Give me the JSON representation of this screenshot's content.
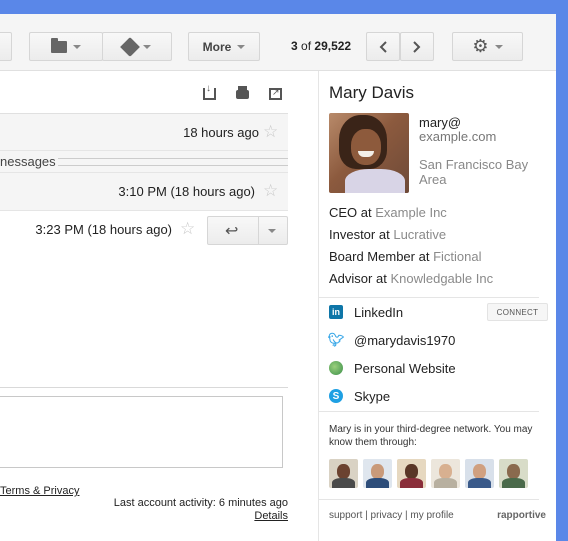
{
  "toolbar": {
    "more_label": "More",
    "count_current": "3",
    "count_of": "of",
    "count_total": "29,522"
  },
  "thread": {
    "messages": [
      {
        "time": "18 hours ago"
      },
      {
        "collapsed_label": "nessages"
      },
      {
        "time": "3:10 PM (18 hours ago)"
      },
      {
        "time": "3:23 PM (18 hours ago)"
      }
    ],
    "terms_link": "Terms & Privacy",
    "last_activity": "Last account activity: 6 minutes ago",
    "details_link": "Details"
  },
  "contact": {
    "name": "Mary Davis",
    "email_line1": "mary@",
    "email_line2": "example.com",
    "location": "San Francisco Bay Area",
    "jobs": [
      {
        "title": "CEO",
        "at": "at",
        "org": "Example Inc"
      },
      {
        "title": "Investor",
        "at": "at",
        "org": "Lucrative"
      },
      {
        "title": "Board Member",
        "at": "at",
        "org": "Fictional"
      },
      {
        "title": "Advisor",
        "at": "at",
        "org": "Knowledgable Inc"
      }
    ],
    "social": {
      "linkedin": "LinkedIn",
      "connect": "CONNECT",
      "twitter": "@marydavis1970",
      "website": "Personal Website",
      "skype": "Skype"
    },
    "network_text": "Mary is in your third-degree network. You may know them through:",
    "avatars": [
      {
        "skin": "#6b4230",
        "hair": "#2a1a10",
        "body": "#4a4a4a"
      },
      {
        "skin": "#c99a7a",
        "hair": "#3a2a1e",
        "body": "#2d4d7a"
      },
      {
        "skin": "#5a3626",
        "hair": "#1e140c",
        "body": "#8a2e3a"
      },
      {
        "skin": "#d8b090",
        "hair": "#6a4a30",
        "body": "#b8b0a0"
      },
      {
        "skin": "#d0a080",
        "hair": "#2e2218",
        "body": "#3a5a8a"
      },
      {
        "skin": "#8a6a4e",
        "hair": "#2a2018",
        "body": "#4a6a4a"
      }
    ],
    "footer": {
      "support": "support",
      "sep": "|",
      "privacy": "privacy",
      "my_profile": "my profile",
      "brand": "rapportive"
    }
  }
}
